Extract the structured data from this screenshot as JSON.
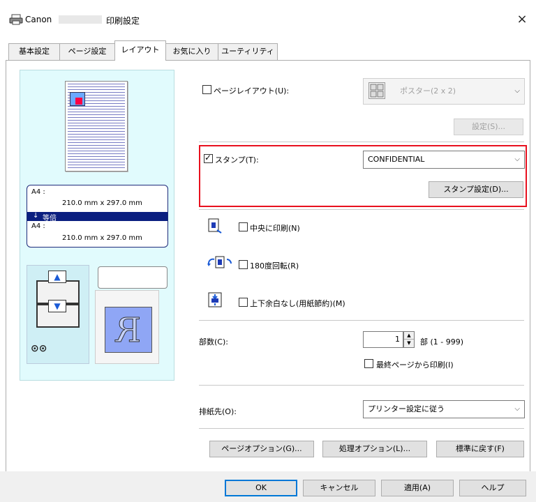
{
  "window": {
    "title_prefix": "Canon",
    "title_suffix": "印刷設定",
    "close": "×"
  },
  "tabs": [
    {
      "label": "基本設定"
    },
    {
      "label": "ページ設定"
    },
    {
      "label": "レイアウト",
      "active": true
    },
    {
      "label": "お気に入り"
    },
    {
      "label": "ユーティリティ"
    }
  ],
  "preview": {
    "size_from_label": "A4 :",
    "size_from_value": "210.0 mm x 297.0 mm",
    "scale_label": "等倍",
    "size_to_label": "A4 :",
    "size_to_value": "210.0 mm x 297.0 mm",
    "paper_glyph": "R"
  },
  "page_layout": {
    "checkbox_label": "ページレイアウト(U):",
    "checked": false,
    "select_value": "ポスター(2 x 2)",
    "settings_button": "設定(S)..."
  },
  "stamp": {
    "checkbox_label": "スタンプ(T):",
    "checked": true,
    "select_value": "CONFIDENTIAL",
    "settings_button": "スタンプ設定(D)..."
  },
  "options": {
    "center_label": "中央に印刷(N)",
    "rotate_label": "180度回転(R)",
    "no_margin_label": "上下余白なし(用紙節約)(M)"
  },
  "copies": {
    "label": "部数(C):",
    "value": "1",
    "unit": "部 (1 - 999)",
    "reverse_label": "最終ページから印刷(I)"
  },
  "output": {
    "label": "排紙先(O):",
    "select_value": "プリンター設定に従う"
  },
  "bottom_buttons": {
    "page_options": "ページオプション(G)...",
    "process_options": "処理オプション(L)...",
    "defaults": "標準に戻す(F)"
  },
  "dialog_buttons": {
    "ok": "OK",
    "cancel": "キャンセル",
    "apply": "適用(A)",
    "help": "ヘルプ"
  },
  "colors": {
    "preview_bg": "#e1fbfd",
    "highlight": "#e8101e",
    "band": "#0b1f80"
  }
}
